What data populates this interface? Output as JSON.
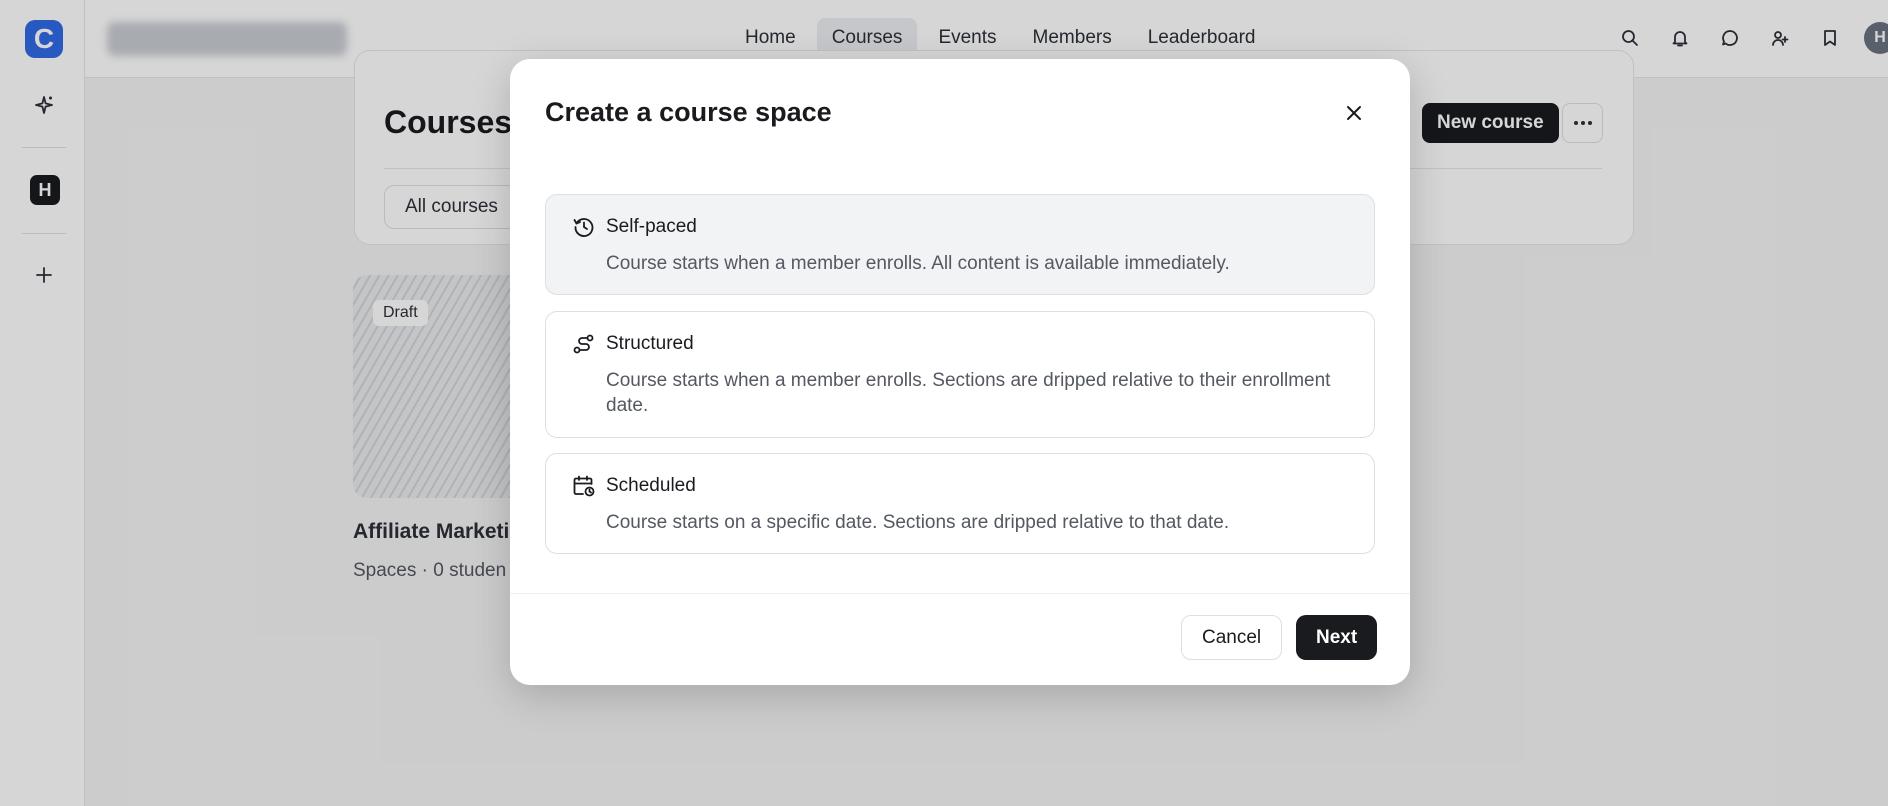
{
  "rail": {
    "logo_letter": "C",
    "space_letter": "H"
  },
  "topbar": {
    "nav": [
      {
        "label": "Home",
        "active": false
      },
      {
        "label": "Courses",
        "active": true
      },
      {
        "label": "Events",
        "active": false
      },
      {
        "label": "Members",
        "active": false
      },
      {
        "label": "Leaderboard",
        "active": false
      }
    ],
    "icons": [
      "search-icon",
      "bell-icon",
      "chat-icon",
      "people-icon",
      "bookmark-icon"
    ],
    "avatar_letter": "H"
  },
  "page": {
    "title": "Courses",
    "filter": "All courses",
    "new_course_label": "New course",
    "card": {
      "badge": "Draft",
      "title": "Affiliate Marketin",
      "meta": "Spaces  ·  0 studen"
    }
  },
  "modal": {
    "title": "Create a course space",
    "options": [
      {
        "title": "Self-paced",
        "description": "Course starts when a member enrolls. All content is available immediately.",
        "icon": "clock-icon",
        "selected": true
      },
      {
        "title": "Structured",
        "description": "Course starts when a member enrolls. Sections are dripped relative to their enrollment date.",
        "icon": "route-icon",
        "selected": false
      },
      {
        "title": "Scheduled",
        "description": "Course starts on a specific date. Sections are dripped relative to that date.",
        "icon": "calendar-clock-icon",
        "selected": false
      }
    ],
    "cancel_label": "Cancel",
    "next_label": "Next"
  },
  "colors": {
    "brand": "#2f6be6",
    "dark": "#191b1f",
    "selected_bg": "#f2f3f5"
  }
}
